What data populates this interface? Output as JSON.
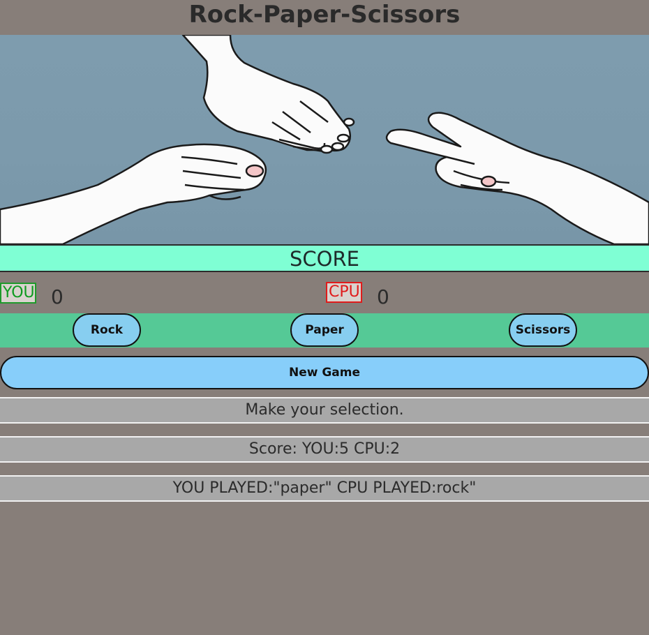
{
  "app": {
    "title": "Rock-Paper-Scissors"
  },
  "hero": {
    "image": "rock-paper-scissors-hands-illustration"
  },
  "score": {
    "header": "SCORE",
    "you_label": "YOU",
    "you_value": "0",
    "cpu_label": "CPU",
    "cpu_value": "0"
  },
  "choices": {
    "rock": "Rock",
    "paper": "Paper",
    "scissors": "Scissors"
  },
  "controls": {
    "new_game": "New Game"
  },
  "messages": {
    "status": "Make your selection.",
    "score_line": "Score: YOU:5 CPU:2",
    "last_play": "YOU PLAYED:\"paper\" CPU PLAYED:rock\""
  },
  "colors": {
    "background": "#877e79",
    "score_bar": "#7fffd4",
    "choice_bar": "#55c996",
    "button": "#87cefa",
    "you_tag": "#0e9b1f",
    "cpu_tag": "#e01b1b",
    "message_bg": "#a8a8a8"
  }
}
